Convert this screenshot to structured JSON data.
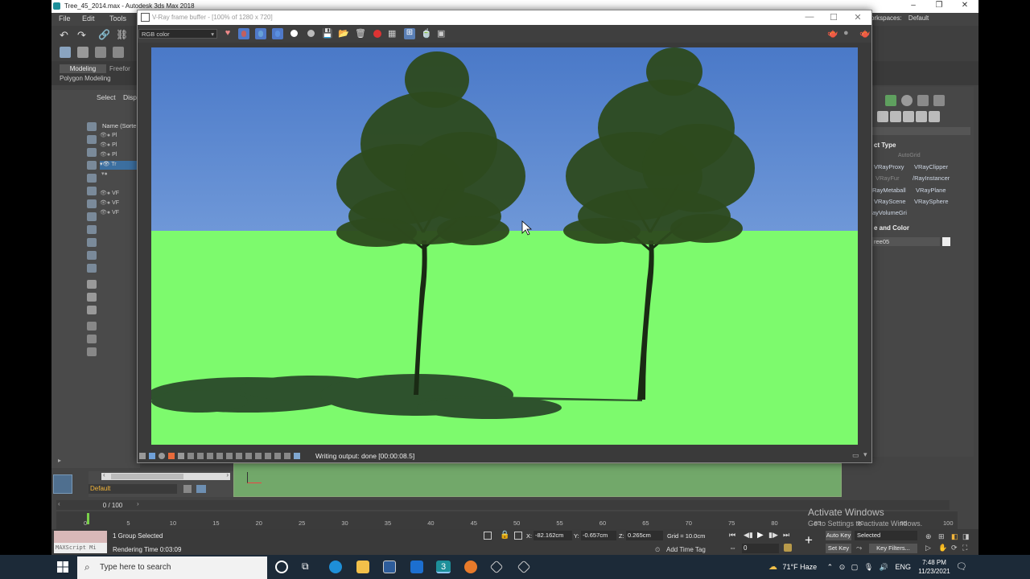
{
  "max": {
    "window_title": "Tree_45_2014.max - Autodesk 3ds Max 2018",
    "menus": [
      "File",
      "Edit",
      "Tools"
    ],
    "workspaces_label": "orkspaces:",
    "workspaces_value": "Default",
    "ribbon_tabs": [
      "Modeling",
      "Freefor"
    ],
    "ribbon_panel": "Polygon Modeling",
    "explorer_tabs": [
      "Select",
      "Disp"
    ],
    "explorer_header": "Name (Sorte",
    "explorer_rows": [
      "Pl",
      "Pl",
      "Pl",
      "Tr",
      "",
      "VF",
      "VF",
      "VF"
    ],
    "controls": {
      "min": "–",
      "max": "❐",
      "close": "✕"
    }
  },
  "command_panel": {
    "section_object_type": "ct Type",
    "autogrid": "AutoGrid",
    "buttons": [
      "VRayProxy",
      "VRayClipper",
      "VRayFur",
      "/RayInstancer",
      "RayMetaball",
      "VRayPlane",
      "VRayScene",
      "VRaySphere",
      "ayVolumeGri"
    ],
    "section_name_color": "e and Color",
    "object_name": "ree05",
    "swatch_color": "#eeeeee"
  },
  "vfb": {
    "title": "V-Ray frame buffer - [100% of 1280 x 720]",
    "channel": "RGB color",
    "status": "Writing output: done [00:00:08.5]",
    "controls": {
      "min": "—",
      "max": "☐",
      "close": "✕"
    }
  },
  "layers": {
    "current": "Default"
  },
  "timeline": {
    "slider_label": "0 / 100",
    "ticks": [
      "0",
      "5",
      "10",
      "15",
      "20",
      "25",
      "30",
      "35",
      "40",
      "45",
      "50",
      "55",
      "60",
      "65",
      "70",
      "75",
      "80",
      "85",
      "90",
      "95",
      "100"
    ]
  },
  "status": {
    "maxscript": "MAXScript Mi",
    "selection": "1 Group Selected",
    "render_time": "Rendering Time  0:03:09",
    "x_label": "X:",
    "x_value": "-82.162cm",
    "y_label": "Y:",
    "y_value": "-0.657cm",
    "z_label": "Z:",
    "z_value": "0.265cm",
    "grid": "Grid = 10.0cm",
    "add_time_tag": "Add Time Tag",
    "frame": "0",
    "auto_key": "Auto Key",
    "set_key": "Set Key",
    "selected": "Selected",
    "key_filters": "Key Filters..."
  },
  "watermark": {
    "title": "Activate Windows",
    "subtitle": "Go to Settings to activate Windows."
  },
  "taskbar": {
    "search_placeholder": "Type here to search",
    "weather": "71°F  Haze",
    "language": "ENG",
    "time": "7:48 PM",
    "date": "11/23/2021"
  },
  "colors": {
    "sky_top": "#4a79c8",
    "sky_bottom": "#6f98d8",
    "ground": "#7dfa6d",
    "tree": "#2d4a1e"
  }
}
